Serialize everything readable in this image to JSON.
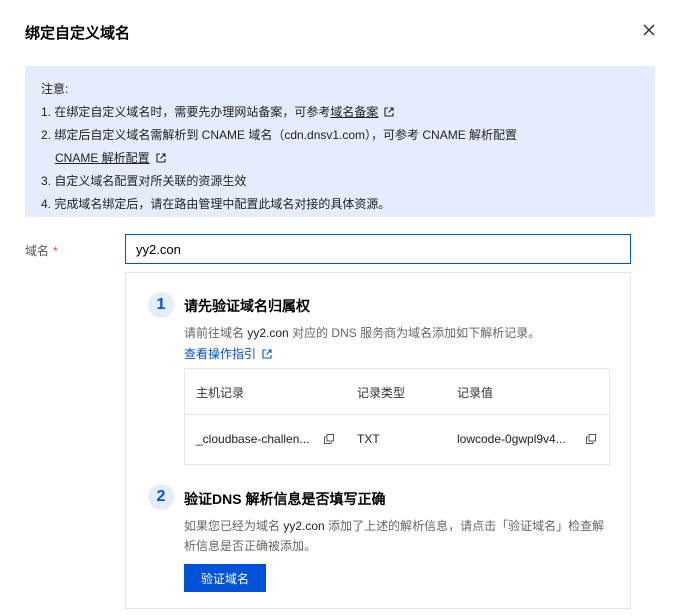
{
  "dialog": {
    "title": "绑定自定义域名"
  },
  "notice": {
    "heading": "注意:",
    "line1_text": "1. 在绑定自定义域名时，需要先办理网站备案，可参考",
    "line1_link": "域名备案",
    "line2_text": "2. 绑定后自定义域名需解析到 CNAME 域名（cdn.dnsv1.com），可参考 CNAME 解析配置",
    "line2_link": "CNAME 解析配置",
    "line3": "3. 自定义域名配置对所关联的资源生效",
    "line4": "4. 完成域名绑定后，请在路由管理中配置此域名对接的具体资源。"
  },
  "form": {
    "domain_label": "域名",
    "required_mark": "*",
    "domain_value": "yy2.con"
  },
  "step1": {
    "number": "1",
    "title": "请先验证域名归属权",
    "desc_prefix": "请前往域名",
    "desc_domain": "yy2.con",
    "desc_suffix": "对应的 DNS 服务商为域名添加如下解析记录。",
    "guide_link": "查看操作指引"
  },
  "dns_table": {
    "headers": [
      "主机记录",
      "记录类型",
      "记录值"
    ],
    "row": {
      "host": "_cloudbase-challen...",
      "type": "TXT",
      "value": "lowcode-0gwpl9v4..."
    }
  },
  "step2": {
    "number": "2",
    "title": "验证DNS 解析信息是否填写正确",
    "desc_line1_prefix": "如果您已经为域名",
    "desc_domain": "yy2.con",
    "desc_line1_suffix": "添加了上述的解析信息，请点击「验证域名」检查解",
    "desc_line2": "析信息是否正确被添加。",
    "button": "验证域名"
  },
  "icons": {
    "close": "close-icon",
    "external": "external-link-icon",
    "copy": "copy-icon"
  },
  "colors": {
    "primary": "#0052d9",
    "notice_bg": "#e5edfc",
    "required": "#e54545"
  }
}
